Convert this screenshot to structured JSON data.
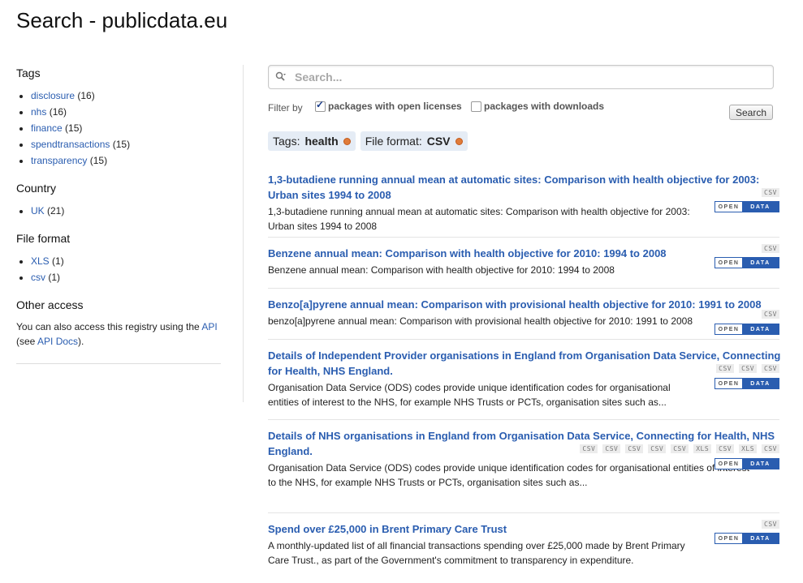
{
  "page": {
    "title": "Search - publicdata.eu"
  },
  "sidebar": {
    "tags_heading": "Tags",
    "tags": [
      {
        "name": "disclosure",
        "count": "(16)"
      },
      {
        "name": "nhs",
        "count": "(16)"
      },
      {
        "name": "finance",
        "count": "(15)"
      },
      {
        "name": "spendtransactions",
        "count": "(15)"
      },
      {
        "name": "transparency",
        "count": "(15)"
      }
    ],
    "country_heading": "Country",
    "countries": [
      {
        "name": "UK",
        "count": "(21)"
      }
    ],
    "format_heading": "File format",
    "formats": [
      {
        "name": "XLS",
        "count": "(1)"
      },
      {
        "name": "csv",
        "count": "(1)"
      }
    ],
    "other_heading": "Other access",
    "other_text_1": "You can also access this registry using the ",
    "api_link": "API",
    "other_text_2": "(see ",
    "api_docs_link": "API Docs",
    "other_text_3": ")."
  },
  "search": {
    "placeholder": "Search...",
    "filter_label": "Filter by",
    "open_licenses_label": "packages with open licenses",
    "downloads_label": "packages with downloads",
    "button": "Search"
  },
  "active_filters": [
    {
      "label": "Tags:",
      "value": "health"
    },
    {
      "label": "File format:",
      "value": "CSV"
    }
  ],
  "badge": {
    "open": "OPEN",
    "data": "DATA"
  },
  "results": [
    {
      "title": "1,3-butadiene running annual mean at automatic sites: Comparison with health objective for 2003: Urban sites 1994 to 2008",
      "desc": "1,3-butadiene running annual mean at automatic sites: Comparison with health objective for 2003: Urban sites 1994 to 2008",
      "formats": [
        "CSV"
      ]
    },
    {
      "title": "Benzene annual mean: Comparison with health objective for 2010: 1994 to 2008",
      "desc": "Benzene annual mean: Comparison with health objective for 2010: 1994 to 2008",
      "formats": [
        "CSV"
      ]
    },
    {
      "title": "Benzo[a]pyrene annual mean: Comparison with provisional health objective for 2010: 1991 to 2008",
      "desc": "benzo[a]pyrene annual mean: Comparison with provisional health objective for 2010: 1991 to 2008",
      "formats": [
        "CSV"
      ]
    },
    {
      "title": "Details of Independent Provider organisations in England from Organisation Data Service, Connecting for Health, NHS England.",
      "desc": "Organisation Data Service (ODS) codes provide unique identification codes for organisational entities of interest to the NHS, for example NHS Trusts or PCTs, organisation sites such as...",
      "formats": [
        "CSV",
        "CSV",
        "CSV"
      ]
    },
    {
      "title": "Details of NHS organisations in England from Organisation Data Service, Connecting for Health, NHS England.",
      "desc": "Organisation Data Service (ODS) codes provide unique identification codes for organisational entities of interest to the NHS, for example NHS Trusts or PCTs, organisation sites such as...",
      "formats": [
        "CSV",
        "CSV",
        "CSV",
        "CSV",
        "CSV",
        "XLS",
        "CSV",
        "XLS",
        "CSV"
      ]
    },
    {
      "title": "Spend over £25,000 in Brent Primary Care Trust",
      "desc": "A monthly-updated list of all financial transactions spending over £25,000 made by Brent Primary Care Trust., as part of the Government's commitment to transparency in expenditure.",
      "formats": [
        "CSV"
      ]
    }
  ]
}
